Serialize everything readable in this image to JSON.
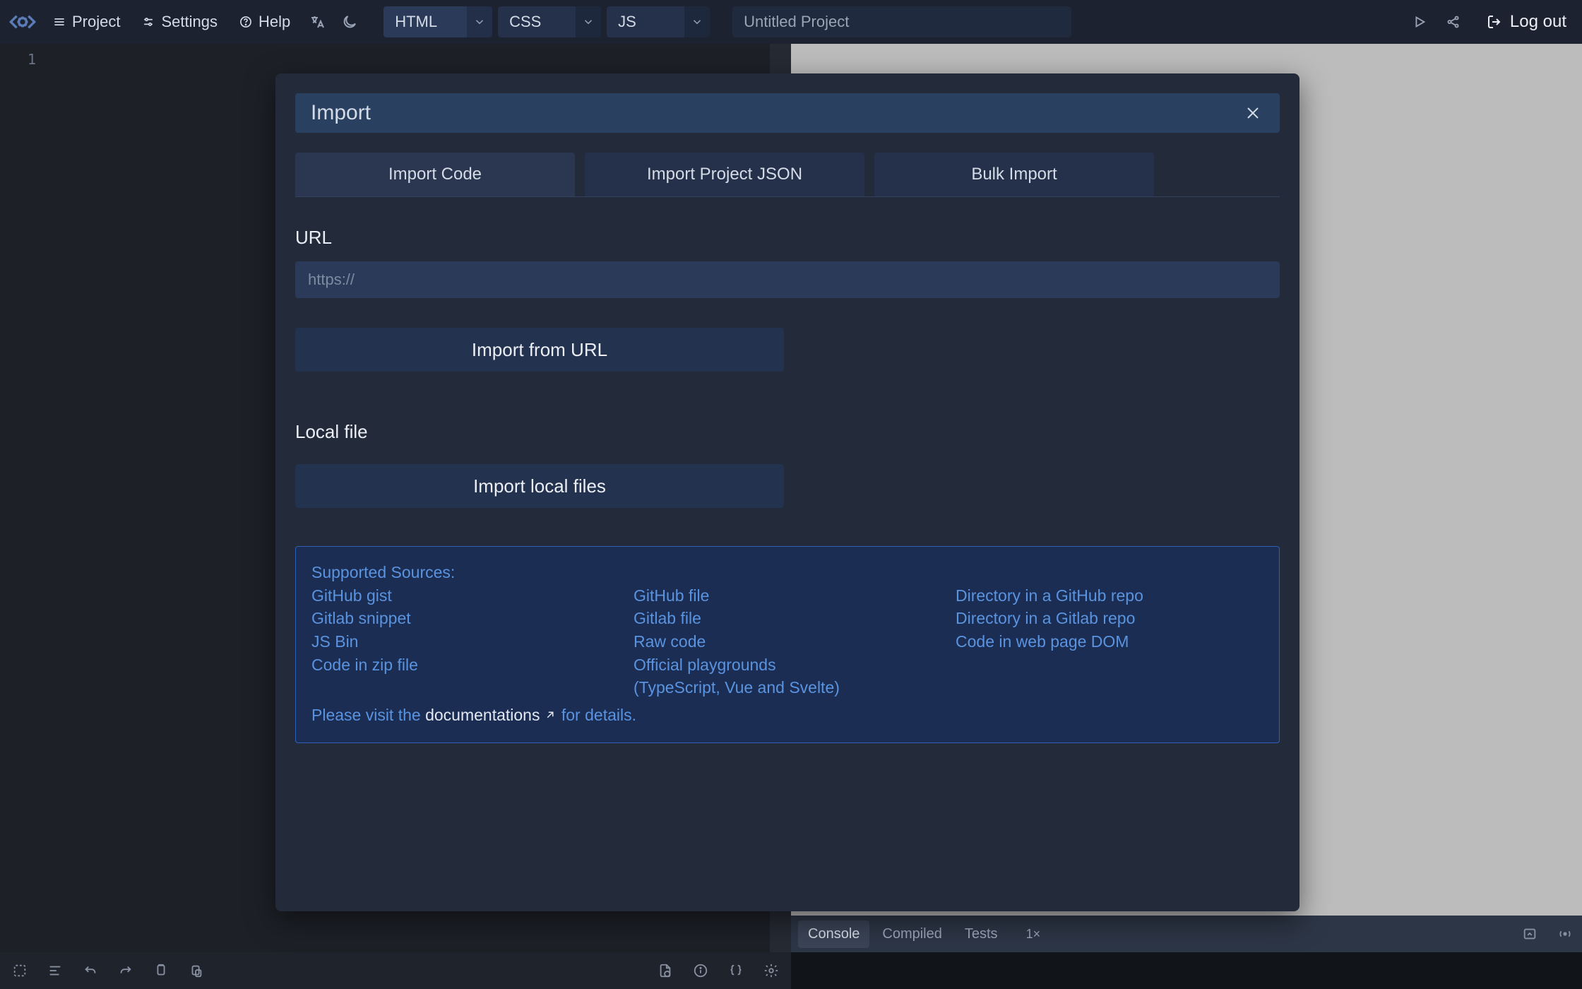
{
  "topbar": {
    "project_label": "Project",
    "settings_label": "Settings",
    "help_label": "Help",
    "logout_label": "Log out",
    "title_value": "Untitled Project"
  },
  "lang_tabs": {
    "html": "HTML",
    "css": "CSS",
    "js": "JS"
  },
  "editor": {
    "line1": "1"
  },
  "console": {
    "tabs": [
      "Console",
      "Compiled",
      "Tests"
    ],
    "zoom_badge": "1×"
  },
  "modal": {
    "title": "Import",
    "tabs": {
      "code": "Import Code",
      "json": "Import Project JSON",
      "bulk": "Bulk Import"
    },
    "url_label": "URL",
    "url_placeholder": "https://",
    "import_url_btn": "Import from URL",
    "local_label": "Local file",
    "import_local_btn": "Import local files",
    "sources_heading": "Supported Sources:",
    "sources_col1": "GitHub gist\nGitlab snippet\nJS Bin\nCode in zip file",
    "sources_col2": "GitHub file\nGitlab file\nRaw code\nOfficial playgrounds\n(TypeScript, Vue and Svelte)",
    "sources_col3": "Directory in a GitHub repo\nDirectory in a Gitlab repo\nCode in web page DOM",
    "footer_pre": "Please visit the ",
    "footer_link": "documentations",
    "footer_post": " for details."
  }
}
